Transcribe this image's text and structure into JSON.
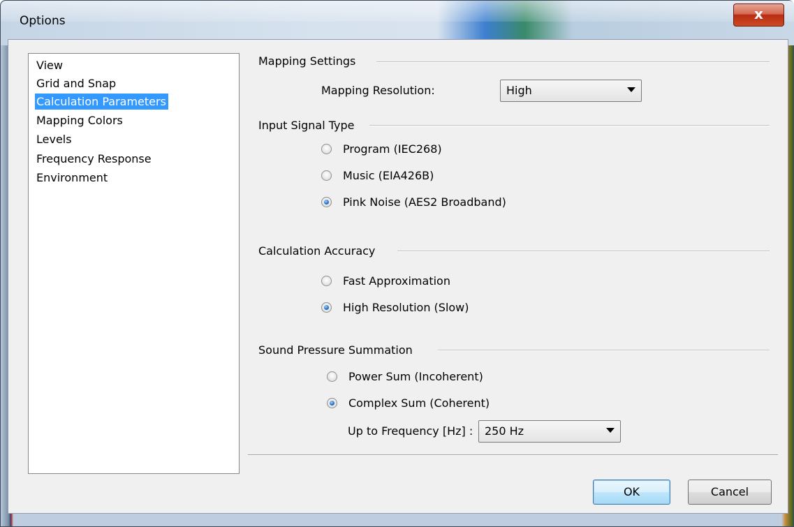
{
  "window": {
    "title": "Options",
    "close_glyph": "x"
  },
  "nav": {
    "items": [
      {
        "label": "View",
        "selected": false
      },
      {
        "label": "Grid and Snap",
        "selected": false
      },
      {
        "label": "Calculation Parameters",
        "selected": true
      },
      {
        "label": "Mapping Colors",
        "selected": false
      },
      {
        "label": "Levels",
        "selected": false
      },
      {
        "label": "Frequency Response",
        "selected": false
      },
      {
        "label": "Environment",
        "selected": false
      }
    ]
  },
  "mapping": {
    "section_title": "Mapping Settings",
    "resolution_label": "Mapping Resolution:",
    "resolution_value": "High"
  },
  "input_signal": {
    "section_title": "Input Signal Type",
    "options": [
      {
        "label": "Program (IEC268)",
        "checked": false
      },
      {
        "label": "Music (EIA426B)",
        "checked": false
      },
      {
        "label": "Pink Noise (AES2 Broadband)",
        "checked": true
      }
    ]
  },
  "accuracy": {
    "section_title": "Calculation Accuracy",
    "options": [
      {
        "label": "Fast Approximation",
        "checked": false
      },
      {
        "label": "High Resolution (Slow)",
        "checked": true
      }
    ]
  },
  "summation": {
    "section_title": "Sound Pressure Summation",
    "options": [
      {
        "label": "Power Sum (Incoherent)",
        "checked": false
      },
      {
        "label": "Complex Sum (Coherent)",
        "checked": true
      }
    ],
    "frequency_label": "Up to Frequency [Hz] :",
    "frequency_value": "250 Hz"
  },
  "buttons": {
    "ok": "OK",
    "cancel": "Cancel"
  },
  "colors": {
    "selection": "#3399ff",
    "dialog_bg": "#f0f0f0",
    "close_button": "#c8472a"
  }
}
